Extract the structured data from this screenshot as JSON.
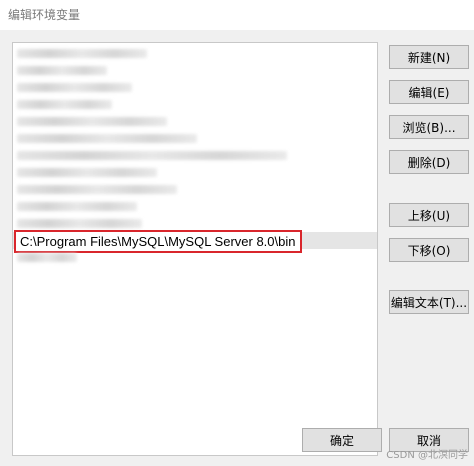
{
  "window": {
    "title": "编辑环境变量"
  },
  "list": {
    "selected_entry": "C:\\Program Files\\MySQL\\MySQL Server 8.0\\bin"
  },
  "buttons": {
    "new": "新建(N)",
    "edit": "编辑(E)",
    "browse": "浏览(B)...",
    "delete": "删除(D)",
    "move_up": "上移(U)",
    "move_down": "下移(O)",
    "edit_text": "编辑文本(T)...",
    "ok": "确定",
    "cancel": "取消"
  },
  "watermark": "CSDN @北溟同学"
}
